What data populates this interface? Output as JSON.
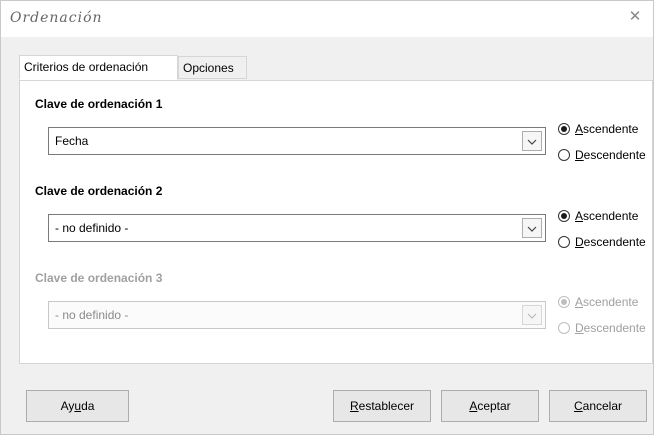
{
  "dialog": {
    "title": "Ordenación"
  },
  "tabs": [
    {
      "label": "Criterios de ordenación",
      "active": true
    },
    {
      "label": "Opciones",
      "active": false
    }
  ],
  "keys": [
    {
      "title": "Clave de ordenación 1",
      "value": "Fecha",
      "enabled": true,
      "ascending_pre": "",
      "ascending_mn": "A",
      "ascending_post": "scendente",
      "descending_pre": "",
      "descending_mn": "D",
      "descending_post": "escendente",
      "selected": "ascending"
    },
    {
      "title": "Clave de ordenación 2",
      "value": "- no definido -",
      "enabled": true,
      "ascending_pre": "",
      "ascending_mn": "A",
      "ascending_post": "scendente",
      "descending_pre": "",
      "descending_mn": "D",
      "descending_post": "escendente",
      "selected": "ascending"
    },
    {
      "title": "Clave de ordenación 3",
      "value": "- no definido -",
      "enabled": false,
      "ascending_pre": "",
      "ascending_mn": "A",
      "ascending_post": "scendente",
      "descending_pre": "",
      "descending_mn": "D",
      "descending_post": "escendente",
      "selected": "ascending"
    }
  ],
  "buttons": {
    "help_pre": "Ay",
    "help_mn": "u",
    "help_post": "da",
    "reset_pre": "",
    "reset_mn": "R",
    "reset_post": "establecer",
    "ok_pre": "",
    "ok_mn": "A",
    "ok_post": "ceptar",
    "cancel_pre": "",
    "cancel_mn": "C",
    "cancel_post": "ancelar"
  }
}
